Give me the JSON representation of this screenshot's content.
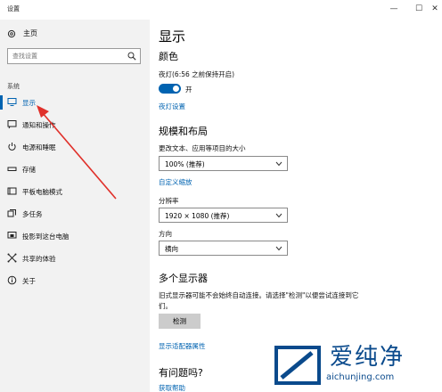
{
  "window": {
    "title": "设置",
    "controls": {
      "minimize": "—",
      "maximize": "☐",
      "close": "✕"
    }
  },
  "sidebar": {
    "home_label": "主页",
    "search_placeholder": "查找设置",
    "section_label": "系统",
    "items": [
      {
        "label": "显示",
        "icon": "monitor-icon",
        "active": true
      },
      {
        "label": "通知和操作",
        "icon": "chat-icon"
      },
      {
        "label": "电源和睡眠",
        "icon": "power-icon"
      },
      {
        "label": "存储",
        "icon": "drive-icon"
      },
      {
        "label": "平板电脑模式",
        "icon": "tablet-icon"
      },
      {
        "label": "多任务",
        "icon": "multitask-icon"
      },
      {
        "label": "投影到这台电脑",
        "icon": "project-icon"
      },
      {
        "label": "共享的体验",
        "icon": "share-icon"
      },
      {
        "label": "关于",
        "icon": "info-icon"
      }
    ]
  },
  "main": {
    "title": "显示",
    "color_heading": "颜色",
    "night_light_label": "夜灯(6:56 之前保持开启)",
    "night_light_state": "开",
    "night_light_link": "夜灯设置",
    "layout_heading": "规模和布局",
    "scale_label": "更改文本、应用等项目的大小",
    "scale_value": "100% (推荐)",
    "custom_scale_link": "自定义缩放",
    "resolution_label": "分辨率",
    "resolution_value": "1920 × 1080 (推荐)",
    "orientation_label": "方向",
    "orientation_value": "横向",
    "multi_display_heading": "多个显示器",
    "multi_display_desc_1": "旧式显示器可能不会始终自动连接。请选择\"检测\"以便尝试连接到它",
    "multi_display_desc_2": "们。",
    "detect_button": "检测",
    "adapter_link": "显示适配器属性",
    "question_heading": "有问题吗?",
    "help_link": "获取帮助"
  },
  "watermark": {
    "name": "爱纯净",
    "url": "aichunjing.com"
  },
  "colors": {
    "accent": "#0063b1",
    "sidebar_bg": "#f2f2f2",
    "arrow": "#e0302a"
  }
}
